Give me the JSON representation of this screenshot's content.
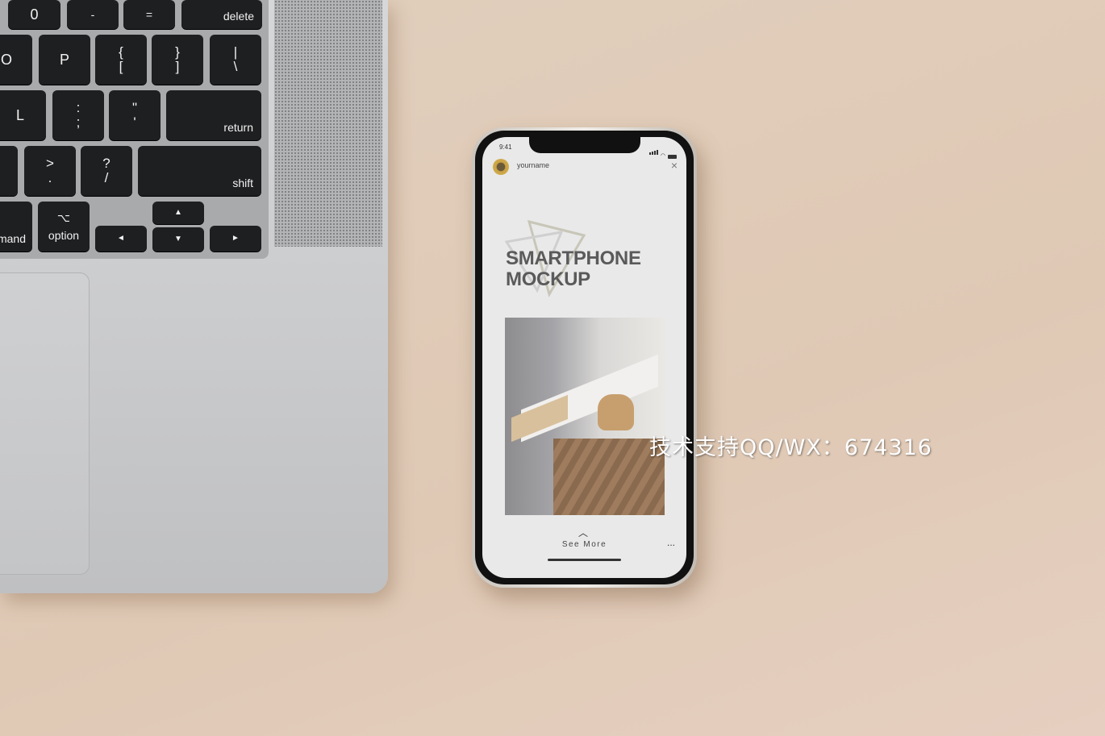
{
  "keyboard": {
    "keys": [
      {
        "label": "0"
      },
      {
        "label": "-"
      },
      {
        "label": "="
      },
      {
        "label": "delete"
      },
      {
        "label": "O"
      },
      {
        "label": "P"
      },
      {
        "label": "{\n["
      },
      {
        "label": "}\n]"
      },
      {
        "label": "|\n\\"
      },
      {
        "label": "L"
      },
      {
        "label": ":\n;"
      },
      {
        "label": "\"\n'"
      },
      {
        "label": "return"
      },
      {
        "label": ">\n."
      },
      {
        "label": "?\n/"
      },
      {
        "label": "shift"
      },
      {
        "label": "mand"
      },
      {
        "label": "⌥\noption"
      },
      {
        "label": "◄"
      },
      {
        "label": "▲"
      },
      {
        "label": "▼"
      },
      {
        "label": "►"
      }
    ]
  },
  "phone": {
    "status_time": "9:41",
    "username": "yourname",
    "headline_1": "SMARTPHONE",
    "headline_2": "MOCKUP",
    "see_more": "See More",
    "more_icon": "...",
    "close_icon": "×"
  },
  "watermark": "技术支持QQ/WX：674316",
  "colors": {
    "background": "#e1cfbd",
    "laptop": "#d0d1d3",
    "keys": "#1e1f21"
  }
}
